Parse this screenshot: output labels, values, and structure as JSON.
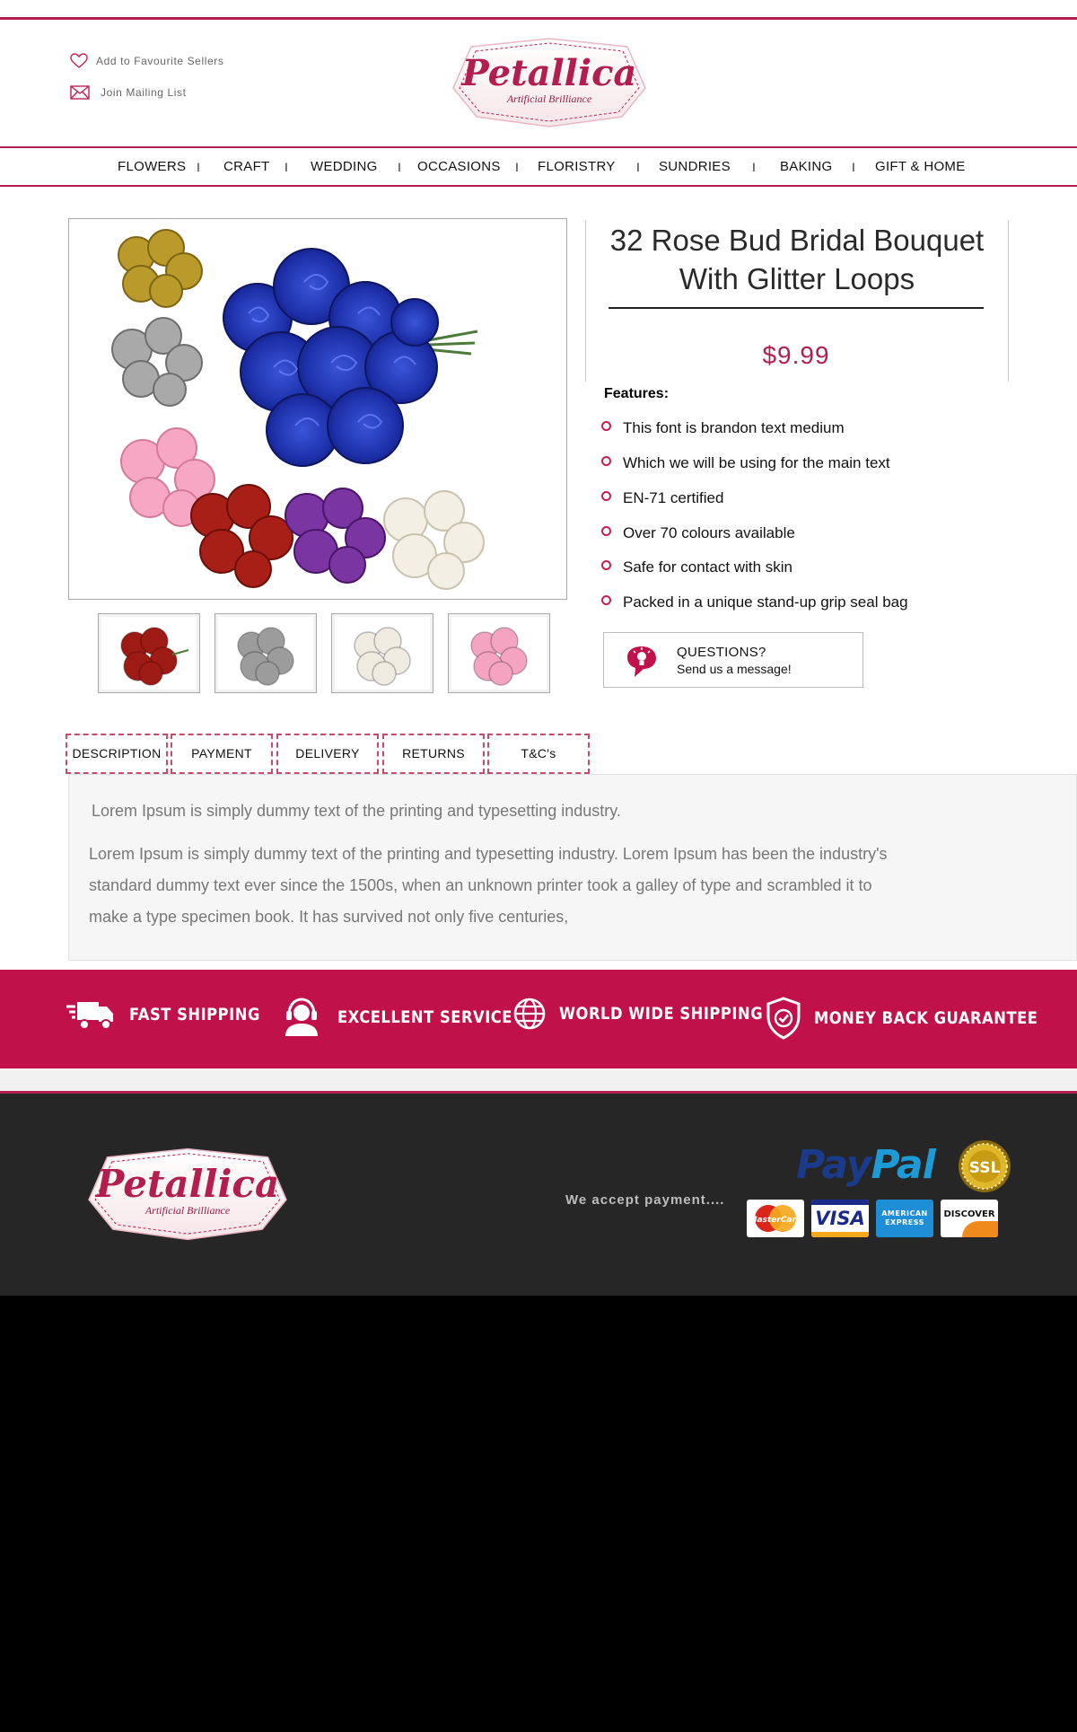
{
  "header": {
    "favourite_label": "Add to Favourite Sellers",
    "mailing_label": "Join Mailing List",
    "logo": {
      "brand": "Petallica",
      "tagline": "Artificial Brilliance"
    }
  },
  "nav": {
    "items": [
      "FLOWERS",
      "CRAFT",
      "WEDDING",
      "OCCASIONS",
      "FLORISTRY",
      "SUNDRIES",
      "BAKING",
      "GIFT & HOME"
    ],
    "separator": "I"
  },
  "product": {
    "title_line1": "32 Rose Bud Bridal Bouquet",
    "title_line2": "With Glitter Loops",
    "price": "$9.99",
    "features_label": "Features:",
    "features": [
      "This font is brandon text medium",
      "Which we will be using for the main text",
      "EN-71 certified",
      "Over 70 colours available",
      "Safe for contact with skin",
      "Packed in a unique stand-up grip seal bag"
    ],
    "thumbnail_colors": [
      "#9e1a14",
      "#9c9c9c",
      "#efebe0",
      "#f4a3c0"
    ]
  },
  "questions": {
    "title": "QUESTIONS?",
    "subtitle": "Send us a message!"
  },
  "tabs": [
    "DESCRIPTION",
    "PAYMENT",
    "DELIVERY",
    "RETURNS",
    "T&C's"
  ],
  "description": {
    "lead": "Lorem Ipsum is simply dummy text of the printing and typesetting industry.",
    "line1": "Lorem Ipsum is simply dummy text of the printing and typesetting industry. Lorem Ipsum has been the industry's",
    "line2": "standard dummy text ever since the 1500s, when an unknown printer took a galley of type and scrambled it to",
    "line3": "make a type specimen book. It has survived not only five centuries,"
  },
  "banner": {
    "items": [
      "FAST SHIPPING",
      "EXCELLENT SERVICE",
      "WORLD WIDE SHIPPING",
      "MONEY BACK GUARANTEE"
    ],
    "icons": [
      "truck-icon",
      "headset-agent-icon",
      "globe-icon",
      "shield-check-icon"
    ]
  },
  "footer": {
    "accept_label": "We accept payment....",
    "paypal_part1": "Pay",
    "paypal_part2": "Pal",
    "ssl_label": "SSL",
    "cards": [
      "MasterCard",
      "VISA",
      "AMERICAN EXPRESS",
      "DISCOVER"
    ]
  },
  "colors": {
    "brand": "#b21e4e",
    "banner": "#c0114a",
    "footer": "#262626",
    "price": "#b21e4e"
  }
}
